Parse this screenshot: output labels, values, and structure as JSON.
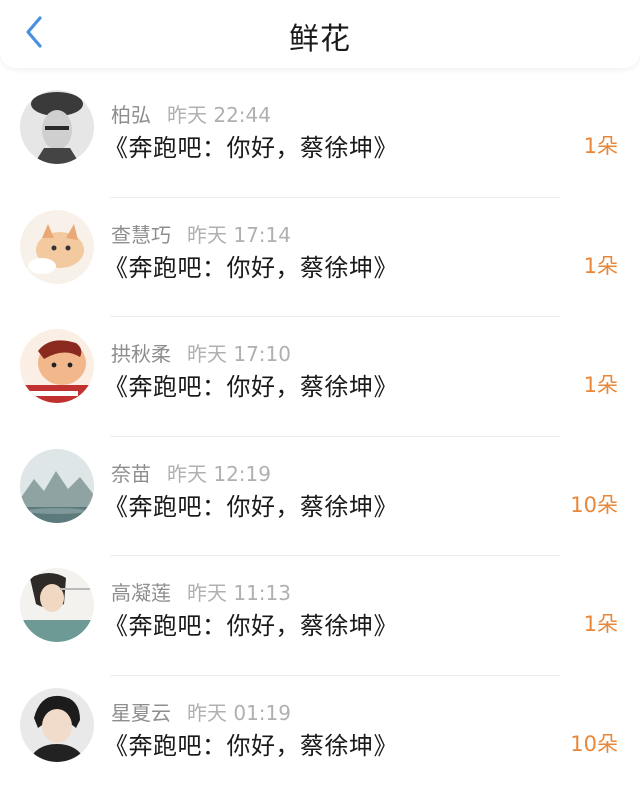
{
  "header": {
    "title": "鲜花",
    "back_icon": "chevron-left-icon",
    "accent_color": "#4a90e2"
  },
  "flowers": [
    {
      "name": "柏弘",
      "time": "昨天 22:44",
      "message": "《奔跑吧：你好，蔡徐坤》",
      "count": "1朵"
    },
    {
      "name": "查慧巧",
      "time": "昨天 17:14",
      "message": "《奔跑吧：你好，蔡徐坤》",
      "count": "1朵"
    },
    {
      "name": "拱秋柔",
      "time": "昨天 17:10",
      "message": "《奔跑吧：你好，蔡徐坤》",
      "count": "1朵"
    },
    {
      "name": "奈苗",
      "time": "昨天 12:19",
      "message": "《奔跑吧：你好，蔡徐坤》",
      "count": "10朵"
    },
    {
      "name": "高凝莲",
      "time": "昨天 11:13",
      "message": "《奔跑吧：你好，蔡徐坤》",
      "count": "1朵"
    },
    {
      "name": "星夏云",
      "time": "昨天 01:19",
      "message": "《奔跑吧：你好，蔡徐坤》",
      "count": "10朵"
    }
  ],
  "colors": {
    "count": "#e8873a",
    "name": "#8e8e8e",
    "time": "#b0b0b0",
    "message": "#1a1a1a"
  }
}
